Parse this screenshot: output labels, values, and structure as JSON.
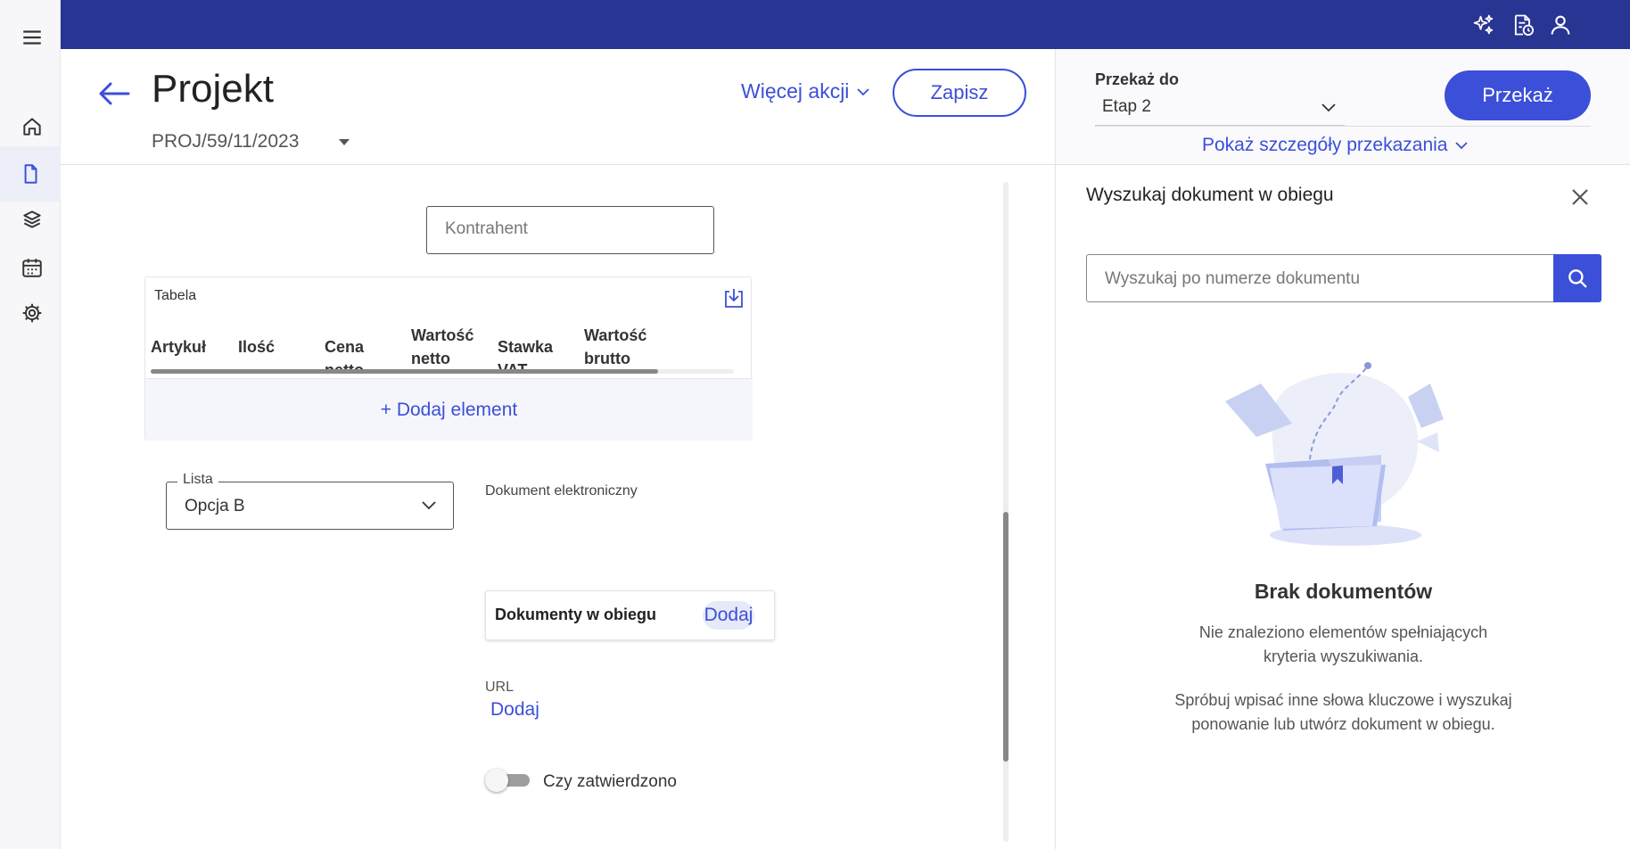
{
  "colors": {
    "topbar": "#283593",
    "accent": "#3b4fd8",
    "text": "#222222",
    "muted": "#555555"
  },
  "rail": {
    "items": [
      {
        "name": "menu",
        "icon": "hamburger-icon"
      },
      {
        "name": "home",
        "icon": "home-icon"
      },
      {
        "name": "documents",
        "icon": "document-icon",
        "active": true
      },
      {
        "name": "layers",
        "icon": "layers-icon"
      },
      {
        "name": "calendar",
        "icon": "calendar-icon"
      },
      {
        "name": "settings",
        "icon": "gear-icon"
      }
    ]
  },
  "topbar": {
    "icons": [
      "sparkles-icon",
      "document-clock-icon",
      "user-icon"
    ]
  },
  "header": {
    "title": "Projekt",
    "doc_number": "PROJ/59/11/2023",
    "more_actions": "Więcej akcji",
    "save": "Zapisz"
  },
  "transfer": {
    "label": "Przekaż do",
    "selected": "Etap 2",
    "button": "Przekaż",
    "details_link": "Pokaż szczegóły przekazania"
  },
  "search_panel": {
    "title": "Wyszukaj dokument w obiegu",
    "placeholder": "Wyszukaj po numerze dokumentu",
    "empty_title": "Brak dokumentów",
    "empty_text_1": [
      "Nie znaleziono elementów spełniających",
      "kryteria wyszukiwania."
    ],
    "empty_text_2": [
      "Spróbuj wpisać inne słowa kluczowe i wyszukaj",
      "ponowanie lub utwórz dokument w obiegu."
    ]
  },
  "form": {
    "kontrahent_placeholder": "Kontrahent",
    "table": {
      "title": "Tabela",
      "columns": [
        "Artykuł",
        "Ilość",
        "Cena netto",
        "Wartość netto",
        "Stawka VAT",
        "Wartość brutto"
      ],
      "add_element": "+ Dodaj element",
      "scroll_fraction": 0.87
    },
    "list": {
      "label": "Lista",
      "value": "Opcja B"
    },
    "edoc_label": "Dokument elektroniczny",
    "docs_in_circulation": {
      "label": "Dokumenty w obiegu",
      "add": "Dodaj"
    },
    "url": {
      "label": "URL",
      "add": "Dodaj"
    },
    "approved": {
      "label": "Czy zatwierdzono",
      "checked": false
    }
  }
}
